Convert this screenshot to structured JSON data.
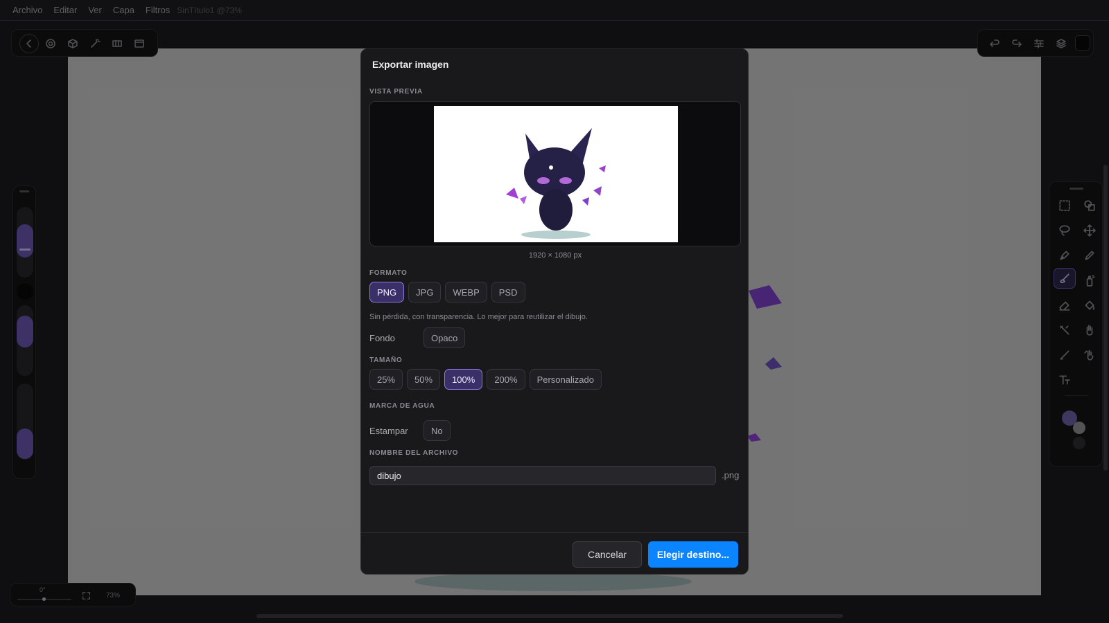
{
  "menu": {
    "items": [
      "Archivo",
      "Editar",
      "Ver",
      "Capa",
      "Filtros"
    ],
    "document": "SinTítulo1 @73%"
  },
  "statusbar": {
    "rotation": "0°",
    "zoom": "73%"
  },
  "icons": {
    "top_left": [
      "back-icon",
      "settings-icon",
      "cube-icon",
      "wand-icon",
      "gradient-icon",
      "window-icon"
    ],
    "top_right": [
      "undo-icon",
      "redo-icon",
      "adjustments-icon",
      "layers-icon"
    ],
    "tools": [
      "marquee-select-icon",
      "shapes-icon",
      "lasso-icon",
      "move-icon",
      "pen-icon",
      "pencil-icon",
      "brush-icon",
      "spray-icon",
      "eraser-icon",
      "fill-bucket-icon",
      "smudge-icon",
      "hand-icon",
      "line-icon",
      "gesture-icon",
      "text-icon"
    ]
  },
  "colors": {
    "accent": "#0a84ff",
    "primary_swatch": "#6e5fa8",
    "secondary_swatch": "#8f8f94",
    "chip_active": "#3b2f68"
  },
  "dialog": {
    "title": "Exportar imagen",
    "preview_label": "VISTA PREVIA",
    "dimensions": "1920 × 1080 px",
    "format_label": "FORMATO",
    "formats": [
      {
        "label": "PNG",
        "selected": true
      },
      {
        "label": "JPG",
        "selected": false
      },
      {
        "label": "WEBP",
        "selected": false
      },
      {
        "label": "PSD",
        "selected": false
      }
    ],
    "format_hint": "Sin pérdida, con transparencia. Lo mejor para reutilizar el dibujo.",
    "background_label": "Fondo",
    "background_value": "Opaco",
    "size_label": "TAMAÑO",
    "sizes": [
      {
        "label": "25%",
        "selected": false
      },
      {
        "label": "50%",
        "selected": false
      },
      {
        "label": "100%",
        "selected": true
      },
      {
        "label": "200%",
        "selected": false
      },
      {
        "label": "Personalizado",
        "selected": false
      }
    ],
    "watermark_label": "MARCA DE AGUA",
    "stamp_label": "Estampar",
    "stamp_value": "No",
    "filename_label": "NOMBRE DEL ARCHIVO",
    "filename_value": "dibujo",
    "extension": ".png",
    "cancel": "Cancelar",
    "confirm": "Elegir destino..."
  }
}
